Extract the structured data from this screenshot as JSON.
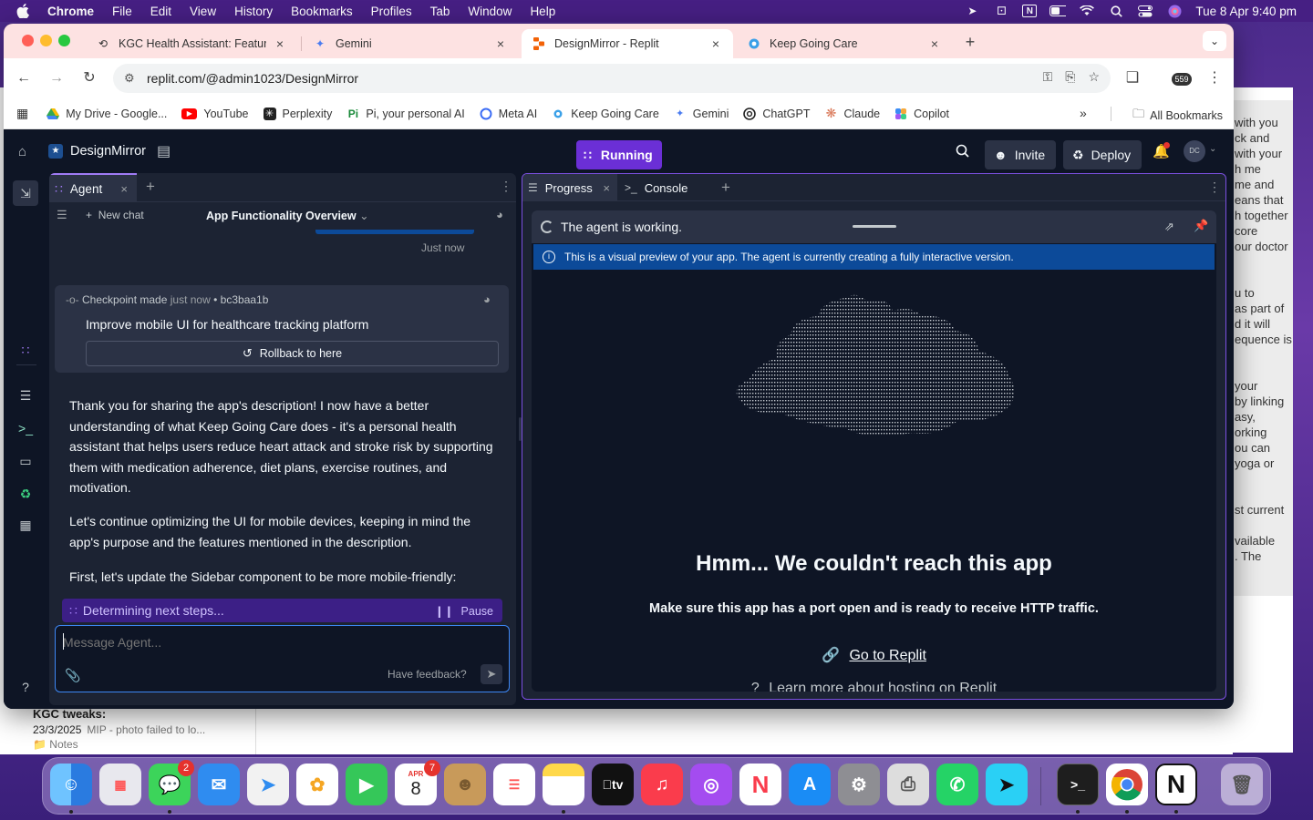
{
  "menubar": {
    "app": "Chrome",
    "items": [
      "File",
      "Edit",
      "View",
      "History",
      "Bookmarks",
      "Profiles",
      "Tab",
      "Window",
      "Help"
    ],
    "datetime": "Tue 8 Apr  9:40 pm"
  },
  "chrome": {
    "tabs": [
      {
        "title": "KGC Health Assistant: Featur",
        "icon": "feature-icon"
      },
      {
        "title": "Gemini",
        "icon": "gemini-icon"
      },
      {
        "title": "DesignMirror - Replit",
        "icon": "replit-icon"
      },
      {
        "title": "Keep Going Care",
        "icon": "kgc-icon"
      }
    ],
    "url": "replit.com/@admin1023/DesignMirror",
    "ext_badge": "559",
    "bookmarks": [
      {
        "label": "My Drive - Google...",
        "icon": "drive-icon"
      },
      {
        "label": "YouTube",
        "icon": "youtube-icon"
      },
      {
        "label": "Perplexity",
        "icon": "perplexity-icon"
      },
      {
        "label": "Pi, your personal AI",
        "icon": "pi-icon"
      },
      {
        "label": "Meta AI",
        "icon": "meta-icon"
      },
      {
        "label": "Keep Going Care",
        "icon": "kgc-icon"
      },
      {
        "label": "Gemini",
        "icon": "gemini-icon"
      },
      {
        "label": "ChatGPT",
        "icon": "chatgpt-icon"
      },
      {
        "label": "Claude",
        "icon": "claude-icon"
      },
      {
        "label": "Copilot",
        "icon": "copilot-icon"
      }
    ],
    "all_bookmarks": "All Bookmarks"
  },
  "replit": {
    "project": "DesignMirror",
    "run_label": "Running",
    "invite": "Invite",
    "deploy": "Deploy",
    "avatar": "DC",
    "agent": {
      "tab": "Agent",
      "new_chat": "New chat",
      "chat_title": "App Functionality Overview",
      "timestamp": "Just now",
      "checkpoint": {
        "label": "Checkpoint made",
        "time": "just now",
        "hash": "bc3baa1b",
        "title": "Improve mobile UI for healthcare tracking platform",
        "rollback": "Rollback to here"
      },
      "messages": [
        "Thank you for sharing the app's description! I now have a better understanding of what Keep Going Care does - it's a personal health assistant that helps users reduce heart attack and stroke risk by supporting them with medication adherence, diet plans, exercise routines, and motivation.",
        "Let's continue optimizing the UI for mobile devices, keeping in mind the app's purpose and the features mentioned in the description.",
        "First, let's update the Sidebar component to be more mobile-friendly:"
      ],
      "status": "Determining next steps...",
      "pause": "Pause",
      "placeholder": "Message Agent...",
      "feedback": "Have feedback?"
    },
    "right": {
      "tab_progress": "Progress",
      "tab_console": "Console",
      "working": "The agent is working.",
      "banner": "This is a visual preview of your app. The agent is currently creating a fully interactive version.",
      "error_title": "Hmm... We couldn't reach this app",
      "error_sub": "Make sure this app has a port open and is ready to receive HTTP traffic.",
      "go_link": "Go to Replit",
      "learn_link": "Learn more about hosting on Replit"
    }
  },
  "notes": {
    "right_lines": [
      "with you",
      "ck and",
      "with your",
      "h me",
      " me and",
      "eans that",
      "h together",
      "core",
      "our doctor",
      "",
      "",
      "u to",
      "as part of",
      "d it will",
      "equence is",
      "",
      "",
      "your",
      "by linking",
      "asy,",
      "orking",
      "ou can",
      "yoga  or",
      "",
      "",
      "st current",
      "",
      "vailable",
      ". The"
    ],
    "item_title": "KGC tweaks:",
    "item_date": "23/3/2025",
    "item_preview": "MIP - photo failed to lo...",
    "item_folder": "Notes"
  },
  "dock": {
    "messages_badge": "2",
    "calendar_month": "APR",
    "calendar_day": "8",
    "calendar_badge": "7",
    "tv_label": "tv"
  }
}
